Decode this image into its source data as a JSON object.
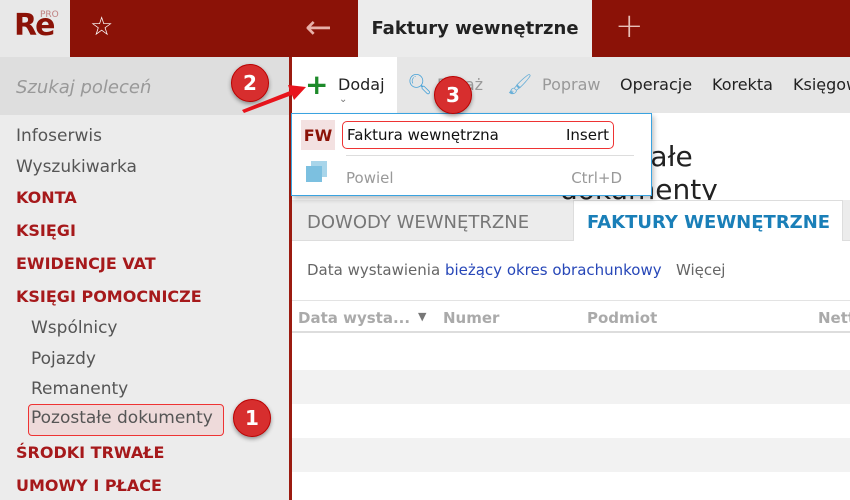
{
  "app": {
    "logo": "Re",
    "logo_sup": "PRO",
    "active_tab": "Faktury wewnętrzne"
  },
  "search": {
    "placeholder": "Szukaj poleceń"
  },
  "sidebar": {
    "items": [
      {
        "label": "Infoserwis",
        "type": "item"
      },
      {
        "label": "Wyszukiwarka",
        "type": "item"
      },
      {
        "label": "KONTA",
        "type": "section"
      },
      {
        "label": "KSIĘGI",
        "type": "section"
      },
      {
        "label": "EWIDENCJE VAT",
        "type": "section"
      },
      {
        "label": "KSIĘGI POMOCNICZE",
        "type": "section"
      },
      {
        "label": "Wspólnicy",
        "type": "sub"
      },
      {
        "label": "Pojazdy",
        "type": "sub"
      },
      {
        "label": "Remanenty",
        "type": "sub"
      },
      {
        "label": "Pozostałe dokumenty",
        "type": "sub"
      },
      {
        "label": "ŚRODKI TRWAŁE",
        "type": "section"
      },
      {
        "label": "UMOWY I PŁACE",
        "type": "section"
      }
    ]
  },
  "toolbar": {
    "add": "Dodaj",
    "show": "Pokaż",
    "edit": "Popraw",
    "operations": "Operacje",
    "correction": "Korekta",
    "post": "Księgow"
  },
  "dropdown": {
    "items": [
      {
        "icon": "FW",
        "label": "Faktura wewnętrzna",
        "shortcut": "Insert"
      },
      {
        "label": "Powiel",
        "shortcut": "Ctrl+D"
      }
    ]
  },
  "page": {
    "title": "Pozostałe dokumenty"
  },
  "tabs": [
    "DOWODY WEWNĘTRZNE",
    "FAKTURY WEWNĘTRZNE"
  ],
  "filter": {
    "label": "Data wystawienia",
    "value": "bieżący okres obrachunkowy",
    "more": "Więcej"
  },
  "columns": [
    "Data wysta...",
    "Numer",
    "Podmiot",
    "Nett"
  ],
  "badges": [
    "1",
    "2",
    "3"
  ],
  "colors": {
    "brand": "#8b1207",
    "accent": "#1a7fb8"
  }
}
